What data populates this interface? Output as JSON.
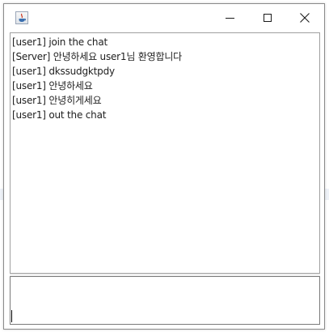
{
  "window": {
    "title": "",
    "controls": {
      "minimize_icon": "minimize-icon",
      "maximize_icon": "maximize-icon",
      "close_icon": "close-icon"
    }
  },
  "chat": {
    "messages": [
      "[user1]  join the chat",
      "[Server] 안녕하세요 user1님 환영합니다",
      "[user1] dkssudgktpdy",
      "[user1] 안녕하세요",
      "[user1] 안녕히게세요",
      "[user1]  out the chat"
    ]
  },
  "input": {
    "value": ""
  },
  "colors": {
    "border": "#a0a0a0",
    "text": "#1e1e1e",
    "background": "#ffffff"
  }
}
